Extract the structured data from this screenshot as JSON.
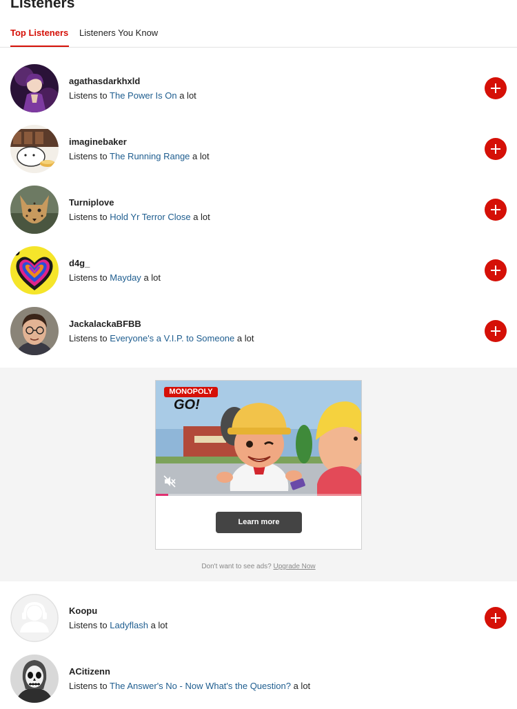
{
  "page": {
    "title": "Listeners"
  },
  "tabs": [
    {
      "label": "Top Listeners",
      "active": true
    },
    {
      "label": "Listeners You Know",
      "active": false
    }
  ],
  "listeners": [
    {
      "name": "agathasdarkhxld",
      "prefix": "Listens to",
      "track": "The Power Is On",
      "suffix": "a lot"
    },
    {
      "name": "imaginebaker",
      "prefix": "Listens to",
      "track": "The Running Range",
      "suffix": "a lot"
    },
    {
      "name": "Turniplove",
      "prefix": "Listens to",
      "track": "Hold Yr Terror Close",
      "suffix": "a lot"
    },
    {
      "name": "d4g_",
      "prefix": "Listens to",
      "track": "Mayday",
      "suffix": "a lot"
    },
    {
      "name": "JackalackaBFBB",
      "prefix": "Listens to",
      "track": "Everyone's a V.I.P. to Someone",
      "suffix": "a lot"
    },
    {
      "name": "Koopu",
      "prefix": "Listens to",
      "track": "Ladyflash",
      "suffix": "a lot"
    },
    {
      "name": "ACitizenn",
      "prefix": "Listens to",
      "track": "The Answer's No - Now What's the Question?",
      "suffix": "a lot"
    }
  ],
  "ad": {
    "brand_top": "MONOPOLY",
    "brand_bottom": "GO!",
    "cta": "Learn more",
    "note": "Don't want to see ads?",
    "upgrade": "Upgrade Now",
    "progress": 0.06
  },
  "colors": {
    "accent": "#d51007",
    "link": "#1e5d8f"
  },
  "icons": {
    "follow": "plus-icon",
    "mute": "muted-speaker-icon"
  }
}
